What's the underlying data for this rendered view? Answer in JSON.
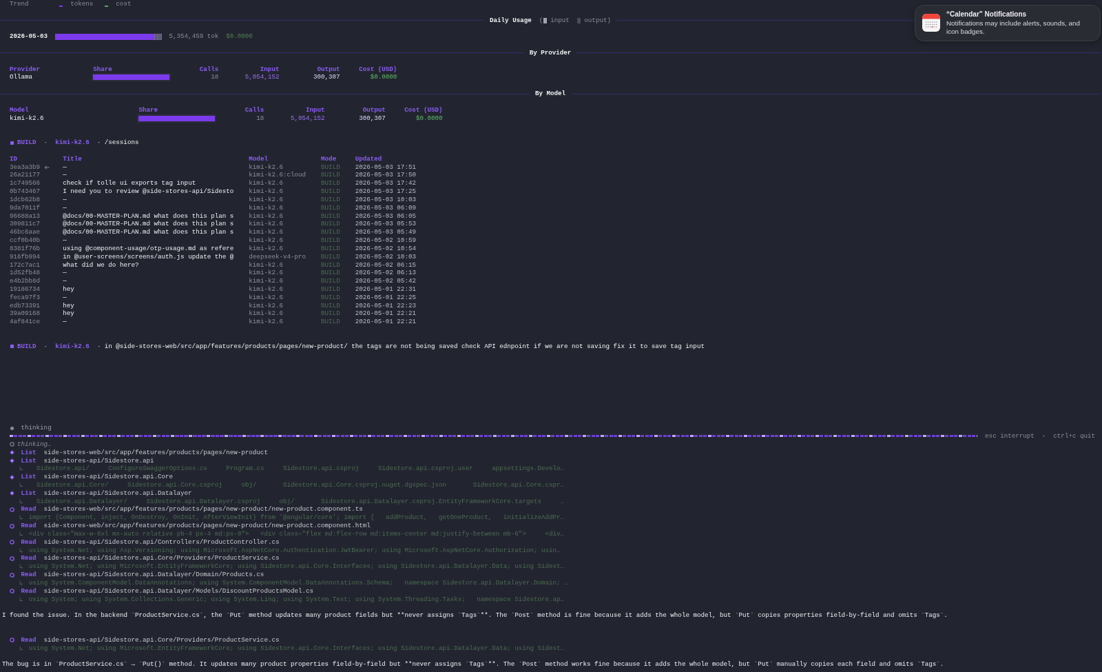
{
  "usage": {
    "trend": {
      "label": "Trend",
      "series": [
        {
          "label": "tokens",
          "color": "#7c3aed"
        },
        {
          "label": "cost",
          "color": "#4caf50"
        }
      ]
    },
    "daily": {
      "title": "Daily Usage",
      "legend": {
        "open": "(",
        "items": [
          {
            "kind": "input",
            "label": "input"
          },
          {
            "kind": "output",
            "label": "output"
          }
        ],
        "close": ")"
      },
      "rows": [
        {
          "date": "2026-05-03",
          "level": 0.93,
          "tokens": "5,354,459 tok",
          "cost": "$0.0000"
        }
      ]
    },
    "by_provider": {
      "title": "By Provider",
      "columns": [
        "Provider",
        "Share",
        "Calls",
        "Input",
        "Output",
        "Cost (USD)"
      ],
      "rows": [
        {
          "name": "Ollama",
          "level": 1,
          "calls": "18",
          "input": "5,054,152",
          "output": "300,307",
          "cost": "$0.0000"
        }
      ]
    },
    "by_model": {
      "title": "By Model",
      "columns": [
        "Model",
        "Share",
        "Calls",
        "Input",
        "Output",
        "Cost (USD)"
      ],
      "rows": [
        {
          "name": "kimi-k2.6",
          "level": 1,
          "calls": "18",
          "input": "5,054,152",
          "output": "300,307",
          "cost": "$0.0000"
        }
      ]
    }
  },
  "sessions": {
    "header": {
      "mode": "BUILD",
      "separators": [
        "·",
        "·"
      ],
      "model": "kimi-k2.6",
      "command": "/sessions"
    },
    "columns": [
      "ID",
      "Title",
      "Model",
      "Mode",
      "Updated"
    ],
    "rows": [
      {
        "id": "3ea3a3b9",
        "current": true,
        "title": "—",
        "model": "kimi-k2.6",
        "mode": "BUILD",
        "updated": "2026-05-03 17:51"
      },
      {
        "id": "26a21177",
        "current": false,
        "title": "—",
        "model": "kimi-k2.6:cloud",
        "mode": "BUILD",
        "updated": "2026-05-03 17:50"
      },
      {
        "id": "1c749566",
        "current": false,
        "title": "check if tolle ui exports tag input",
        "model": "kimi-k2.6",
        "mode": "BUILD",
        "updated": "2026-05-03 17:42"
      },
      {
        "id": "0b743467",
        "current": false,
        "title": "I need you to review @side-stores-api/Sidesto",
        "model": "kimi-k2.6",
        "mode": "BUILD",
        "updated": "2026-05-03 17:25"
      },
      {
        "id": "1dcb62b8",
        "current": false,
        "title": "—",
        "model": "kimi-k2.6",
        "mode": "BUILD",
        "updated": "2026-05-03 10:03"
      },
      {
        "id": "9da7011f",
        "current": false,
        "title": "—",
        "model": "kimi-k2.6",
        "mode": "BUILD",
        "updated": "2026-05-03 06:09"
      },
      {
        "id": "96688a13",
        "current": false,
        "title": "@docs/00-MASTER-PLAN.md what does this plan s",
        "model": "kimi-k2.6",
        "mode": "BUILD",
        "updated": "2026-05-03 06:05"
      },
      {
        "id": "309811c7",
        "current": false,
        "title": "@docs/00-MASTER-PLAN.md what does this plan s",
        "model": "kimi-k2.6",
        "mode": "BUILD",
        "updated": "2026-05-03 05:53"
      },
      {
        "id": "46bc6aae",
        "current": false,
        "title": "@docs/00-MASTER-PLAN.md what does this plan s",
        "model": "kimi-k2.6",
        "mode": "BUILD",
        "updated": "2026-05-03 05:49"
      },
      {
        "id": "ccf0b40b",
        "current": false,
        "title": "—",
        "model": "kimi-k2.6",
        "mode": "BUILD",
        "updated": "2026-05-02 10:59"
      },
      {
        "id": "8381f76b",
        "current": false,
        "title": "using @component-usage/otp-usage.md as refere",
        "model": "kimi-k2.6",
        "mode": "BUILD",
        "updated": "2026-05-02 10:54"
      },
      {
        "id": "916fb994",
        "current": false,
        "title": "in @user-screens/screens/auth.js update the @",
        "model": "deepseek-v4-pro",
        "mode": "BUILD",
        "updated": "2026-05-02 10:03"
      },
      {
        "id": "172c7ac1",
        "current": false,
        "title": "what did we do here?",
        "model": "kimi-k2.6",
        "mode": "BUILD",
        "updated": "2026-05-02 06:15"
      },
      {
        "id": "1d52fb48",
        "current": false,
        "title": "—",
        "model": "kimi-k2.6",
        "mode": "BUILD",
        "updated": "2026-05-02 06:13"
      },
      {
        "id": "e4b2bb8d",
        "current": false,
        "title": "—",
        "model": "kimi-k2.6",
        "mode": "BUILD",
        "updated": "2026-05-02 05:42"
      },
      {
        "id": "19186734",
        "current": false,
        "title": "hey",
        "model": "kimi-k2.6",
        "mode": "BUILD",
        "updated": "2026-05-01 22:31"
      },
      {
        "id": "feca97f3",
        "current": false,
        "title": "—",
        "model": "kimi-k2.6",
        "mode": "BUILD",
        "updated": "2026-05-01 22:25"
      },
      {
        "id": "edb73391",
        "current": false,
        "title": "hey",
        "model": "kimi-k2.6",
        "mode": "BUILD",
        "updated": "2026-05-01 22:23"
      },
      {
        "id": "39a09168",
        "current": false,
        "title": "hey",
        "model": "kimi-k2.6",
        "mode": "BUILD",
        "updated": "2026-05-01 22:21"
      },
      {
        "id": "4af841ce",
        "current": false,
        "title": "—",
        "model": "kimi-k2.6",
        "mode": "BUILD",
        "updated": "2026-05-01 22:21"
      }
    ]
  },
  "prompt": {
    "mode": "BUILD",
    "separators": [
      "·",
      "·"
    ],
    "model": "kimi-k2.6",
    "text": "in @side-stores-web/src/app/features/products/pages/new-product/ the tags are not being saved check API ednpoint if we are not saving fix it to save tag input"
  },
  "status": {
    "label": "thinking",
    "hints": [
      "esc interrupt",
      "ctrl+c quit"
    ],
    "hint_separator": "·"
  },
  "transcript": [
    {
      "kind": "thinking",
      "text": "thinking…"
    },
    {
      "kind": "list",
      "label": "List",
      "path": "side-stores-web/src/app/features/products/pages/new-product"
    },
    {
      "kind": "list",
      "label": "List",
      "path": "side-stores-api/Sidestore.api",
      "output": {
        "marker": "↳",
        "text": "Sidestore.api/     ConfigureSwaggerOptions.cs     Program.cs     Sidestore.api.csproj     Sidestore.api.csproj.user     appsettings.Develo…"
      }
    },
    {
      "kind": "list",
      "label": "List",
      "path": "side-stores-api/Sidestore.api.Core",
      "output": {
        "marker": "↳",
        "text": "Sidestore.api.Core/     Sidestore.api.Core.csproj     obj/       Sidestore.api.Core.csproj.nuget.dgspec.json       Sidestore.api.Core.cspr…"
      }
    },
    {
      "kind": "list",
      "label": "List",
      "path": "side-stores-api/Sidestore.api.Datalayer",
      "output": {
        "marker": "↳",
        "text": "Sidestore.api.Datalayer/     Sidestore.api.Datalayer.csproj     obj/       Sidestore.api.Datalayer.csproj.EntityFrameworkCore.targets     …"
      }
    },
    {
      "kind": "read",
      "label": "Read",
      "path": "side-stores-web/src/app/features/products/pages/new-product/new-product.component.ts",
      "output": {
        "marker": "↳",
        "text": "import {Component, inject, OnDestroy, OnInit, AfterViewInit} from '@angular/core'; import {   addProduct,   getOneProduct,   initializeAddPr…"
      }
    },
    {
      "kind": "read",
      "label": "Read",
      "path": "side-stores-web/src/app/features/products/pages/new-product/new-product.component.html",
      "output": {
        "marker": "↳",
        "text": "<div class=\"max-w-6xl mx-auto relative pb-4 px-4 md:px-0\">   <div class=\"flex md:flex-row md:items-center md:justify-between mb-6\">     <div…"
      }
    },
    {
      "kind": "read",
      "label": "Read",
      "path": "side-stores-api/Sidestore.api/Controllers/ProductController.cs",
      "output": {
        "marker": "↳",
        "text": "using System.Net; using Asp.Versioning; using Microsoft.AspNetCore.Authentication.JwtBearer; using Microsoft.AspNetCore.Authorization; usin…"
      }
    },
    {
      "kind": "read",
      "label": "Read",
      "path": "side-stores-api/Sidestore.api.Core/Providers/ProductService.cs",
      "output": {
        "marker": "↳",
        "text": "using System.Net; using Microsoft.EntityFrameworkCore; using Sidestore.api.Core.Interfaces; using Sidestore.api.Datalayer.Data; using Sidest…"
      }
    },
    {
      "kind": "read",
      "label": "Read",
      "path": "side-stores-api/Sidestore.api.Datalayer/Domain/Products.cs",
      "output": {
        "marker": "↳",
        "text": "using System.ComponentModel.DataAnnotations; using System.ComponentModel.DataAnnotations.Schema;   namespace Sidestore.api.Datalayer.Domain; …"
      }
    },
    {
      "kind": "read",
      "label": "Read",
      "path": "side-stores-api/Sidestore.api.Datalayer/Models/DiscountProductsModel.cs",
      "output": {
        "marker": "↳",
        "text": "using System; using System.Collections.Generic; using System.Linq; using System.Text; using System.Threading.Tasks;   namespace Sidestore.ap…"
      }
    },
    {
      "kind": "message",
      "text": "I found the issue. In the backend `ProductService.cs`, the `Put` method updates many product fields but **never assigns `Tags`**. The `Post` method is fine because it adds the whole model, but `Put` copies properties field-by-field and omits `Tags`."
    },
    {
      "kind": "read",
      "label": "Read",
      "path": "side-stores-api/Sidestore.api.Core/Providers/ProductService.cs",
      "output": {
        "marker": "↳",
        "text": "using System.Net; using Microsoft.EntityFrameworkCore; using Sidestore.api.Core.Interfaces; using Sidestore.api.Datalayer.Data; using Sidest…"
      }
    },
    {
      "kind": "message",
      "text": "The bug is in `ProductService.cs` → `Put()` method. It updates many product properties field-by-field but **never assigns `Tags`**. The `Post` method works fine because it adds the whole model, but `Put` manually copies each field and omits `Tags`."
    }
  ],
  "notification": {
    "title": "“Calendar” Notifications",
    "body": "Notifications may include alerts, sounds, and icon badges."
  }
}
